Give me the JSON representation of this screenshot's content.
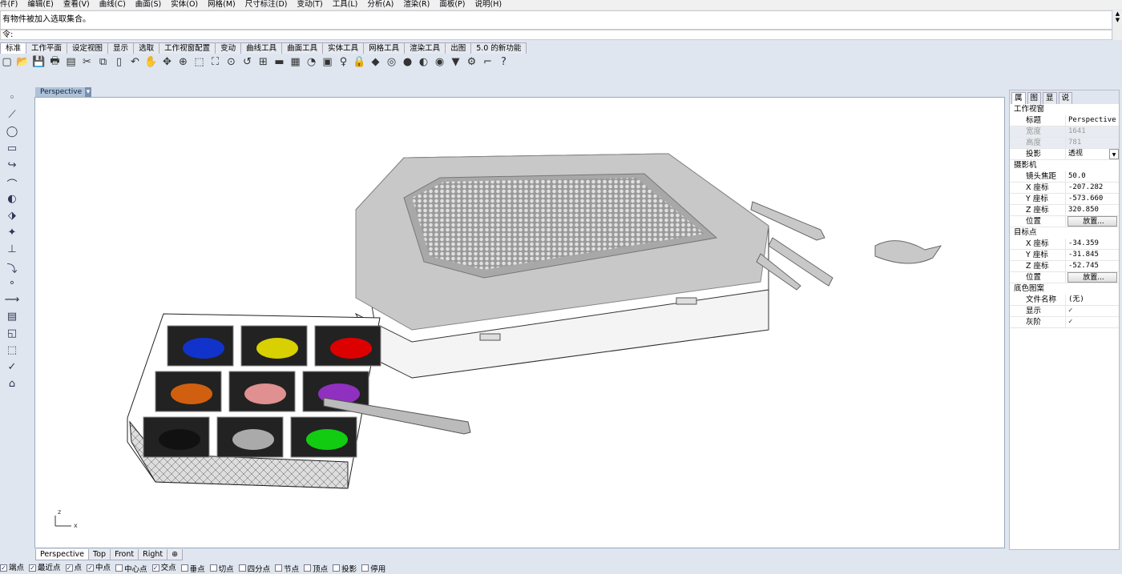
{
  "menu": [
    "件(F)",
    "编辑(E)",
    "查看(V)",
    "曲线(C)",
    "曲面(S)",
    "实体(O)",
    "网格(M)",
    "尺寸标注(D)",
    "变动(T)",
    "工具(L)",
    "分析(A)",
    "渲染(R)",
    "面板(P)",
    "说明(H)"
  ],
  "command": {
    "history": "有物件被加入选取集合。",
    "prompt": "令:"
  },
  "toolbar_tabs": [
    "标准",
    "工作平面",
    "设定视图",
    "显示",
    "选取",
    "工作视窗配置",
    "变动",
    "曲线工具",
    "曲面工具",
    "实体工具",
    "网格工具",
    "渲染工具",
    "出图",
    "5.0 的新功能"
  ],
  "toolbar_icons": [
    "new-icon",
    "open-icon",
    "save-icon",
    "print-icon",
    "import-icon",
    "cut-icon",
    "copy-icon",
    "paste-icon",
    "undo-icon",
    "pan-icon",
    "rotate-icon",
    "zoom-icon",
    "zoom-window-icon",
    "zoom-extents-icon",
    "zoom-selected-icon",
    "undo-view-icon",
    "viewports-icon",
    "car-icon",
    "grid-icon",
    "circle-icon",
    "layer-icon",
    "light-icon",
    "lock-icon",
    "material-icon",
    "color-wheel-icon",
    "shaded-icon",
    "rendered-icon",
    "render-icon",
    "light-cone-icon",
    "options-icon",
    "dimension-icon",
    "help-icon"
  ],
  "viewport": {
    "title": "Perspective",
    "axes": {
      "x": "x",
      "z": "z"
    }
  },
  "viewport_tabs": [
    "Perspective",
    "Top",
    "Front",
    "Right"
  ],
  "panel": {
    "tabs": [
      "属",
      "图",
      "显",
      "说"
    ],
    "sections": [
      {
        "title": "工作视窗",
        "rows": [
          {
            "k": "标题",
            "v": "Perspective"
          },
          {
            "k": "宽度",
            "v": "1641",
            "disabled": true
          },
          {
            "k": "高度",
            "v": "781",
            "disabled": true
          },
          {
            "k": "投影",
            "v": "透视",
            "dropdown": true
          }
        ]
      },
      {
        "title": "摄影机",
        "rows": [
          {
            "k": "镜头焦距",
            "v": "50.0"
          },
          {
            "k": "X 座标",
            "v": "-207.282"
          },
          {
            "k": "Y 座标",
            "v": "-573.660"
          },
          {
            "k": "Z 座标",
            "v": "320.850"
          },
          {
            "k": "位置",
            "v": "放置...",
            "button": true
          }
        ]
      },
      {
        "title": "目标点",
        "rows": [
          {
            "k": "X 座标",
            "v": "-34.359"
          },
          {
            "k": "Y 座标",
            "v": "-31.845"
          },
          {
            "k": "Z 座标",
            "v": "-52.745"
          },
          {
            "k": "位置",
            "v": "放置...",
            "button": true
          }
        ]
      },
      {
        "title": "底色图案",
        "rows": [
          {
            "k": "文件名称",
            "v": "(无)"
          },
          {
            "k": "显示",
            "v": "✓",
            "check": true
          },
          {
            "k": "灰阶",
            "v": "✓",
            "check": true
          }
        ]
      }
    ]
  },
  "osnap": [
    {
      "label": "端点",
      "checked": true
    },
    {
      "label": "最近点",
      "checked": true
    },
    {
      "label": "点",
      "checked": true
    },
    {
      "label": "中点",
      "checked": true
    },
    {
      "label": "中心点",
      "checked": false
    },
    {
      "label": "交点",
      "checked": true
    },
    {
      "label": "垂点",
      "checked": false
    },
    {
      "label": "切点",
      "checked": false
    },
    {
      "label": "四分点",
      "checked": false
    },
    {
      "label": "节点",
      "checked": false
    },
    {
      "label": "顶点",
      "checked": false
    },
    {
      "label": "投影",
      "checked": false
    },
    {
      "label": "停用",
      "checked": false
    }
  ],
  "bead_colors": [
    "#1133cc",
    "#d8d000",
    "#dd0000",
    "#d06010",
    "#e09090",
    "#9030c0",
    "#111111",
    "#aaaaaa",
    "#11cc11"
  ]
}
